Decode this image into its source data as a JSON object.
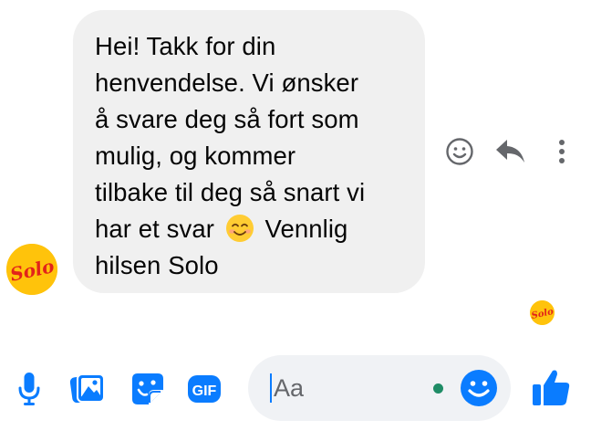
{
  "colors": {
    "accent": "#0a7cff",
    "bubble_bg": "#f0f0f0",
    "input_bg": "#f0f2f5",
    "action_gray": "#65676b",
    "presence": "#1f8c66",
    "brand_yellow": "#ffc30b",
    "brand_red": "#e2231a"
  },
  "sender": {
    "brand_text": "Solo",
    "avatar_icon": "solo-logo",
    "read_receipt_icon": "solo-logo"
  },
  "message": {
    "lines": [
      "Hei! Takk for din",
      "henvendelse. Vi ønsker",
      "å svare deg så fort som",
      "mulig, og kommer",
      "tilbake til deg så snart vi",
      "har et svar",
      "Vennlig",
      "hilsen Solo"
    ],
    "emoji_icon": "smiling-face-emoji"
  },
  "message_actions": [
    {
      "name": "react",
      "icon": "smiley-icon"
    },
    {
      "name": "reply",
      "icon": "reply-icon"
    },
    {
      "name": "more",
      "icon": "more-vertical-icon"
    }
  ],
  "composer": {
    "placeholder": "Aa",
    "value": "",
    "icons": [
      "microphone-icon",
      "photo-icon",
      "sticker-icon",
      "gif-icon",
      "emoji-icon",
      "thumbs-up-icon"
    ],
    "gif_label": "GIF"
  }
}
